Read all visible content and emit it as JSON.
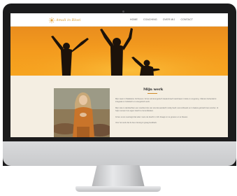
{
  "site": {
    "logo_text": "Amali in Bloei",
    "nav": [
      "HOME",
      "COACHING",
      "OVER MIJ",
      "CONTACT"
    ]
  },
  "section": {
    "title": "Mijn werk",
    "paragraphs": [
      "Mijn naam is Madeleine Verhoeven. Ik ben als Energetisch Healer/coach werkzaam in Ede en omgeving. Cliënten behandel ik integraal en holistisch en energetisch werk.",
      "Mijn visie is dat klachten een manifest zijn van iets dat aandacht nodig heeft; wat ontbreekt en in balans gebracht kan worden. Ik help mensen hun eigen kracht te herontdekken.",
      "Ik ben ervan overtuigd dat ieder mens de kracht in zich draagt om te groeien en te bloeien.",
      "Voor het werk dat ik doe ontvang ik graag feedback."
    ]
  },
  "colors": {
    "accent": "#d79a2a",
    "hero_orange": "#f39a1e",
    "page_background": "#f4eee2"
  },
  "icons": {
    "logo": "sun-flower-logo-icon"
  }
}
